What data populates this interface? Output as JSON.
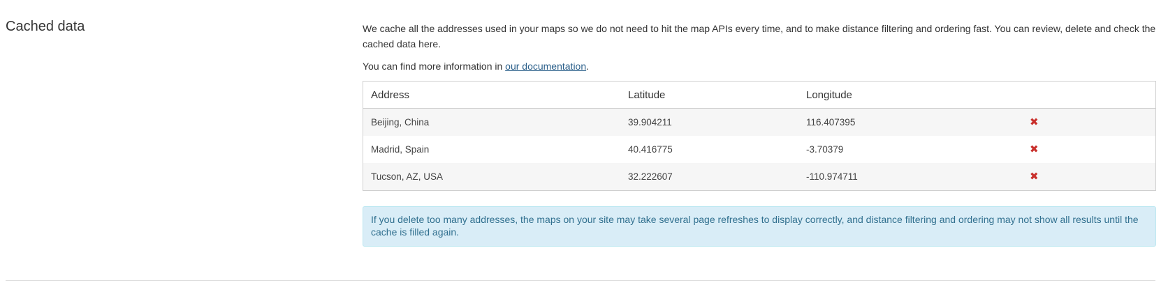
{
  "section": {
    "title": "Cached data"
  },
  "intro": {
    "text": "We cache all the addresses used in your maps so we do not need to hit the map APIs every time, and to make distance filtering and ordering fast. You can review, delete and check the cached data here."
  },
  "more_info": {
    "prefix": "You can find more information in ",
    "link_text": "our documentation",
    "suffix": "."
  },
  "table": {
    "headers": {
      "address": "Address",
      "latitude": "Latitude",
      "longitude": "Longitude"
    },
    "rows": [
      {
        "address": "Beijing, China",
        "latitude": "39.904211",
        "longitude": "116.407395",
        "delete": "✖"
      },
      {
        "address": "Madrid, Spain",
        "latitude": "40.416775",
        "longitude": "-3.70379",
        "delete": "✖"
      },
      {
        "address": "Tucson, AZ, USA",
        "latitude": "32.222607",
        "longitude": "-110.974711",
        "delete": "✖"
      }
    ]
  },
  "alert": {
    "text": "If you delete too many addresses, the maps on your site may take several page refreshes to display correctly, and distance filtering and ordering may not show all results until the cache is filled again."
  },
  "colors": {
    "delete_icon": "#c9302c",
    "link": "#2a5f8a",
    "alert_background": "#d9edf7",
    "alert_text": "#31708f"
  },
  "icons": {
    "delete": "close-icon"
  }
}
